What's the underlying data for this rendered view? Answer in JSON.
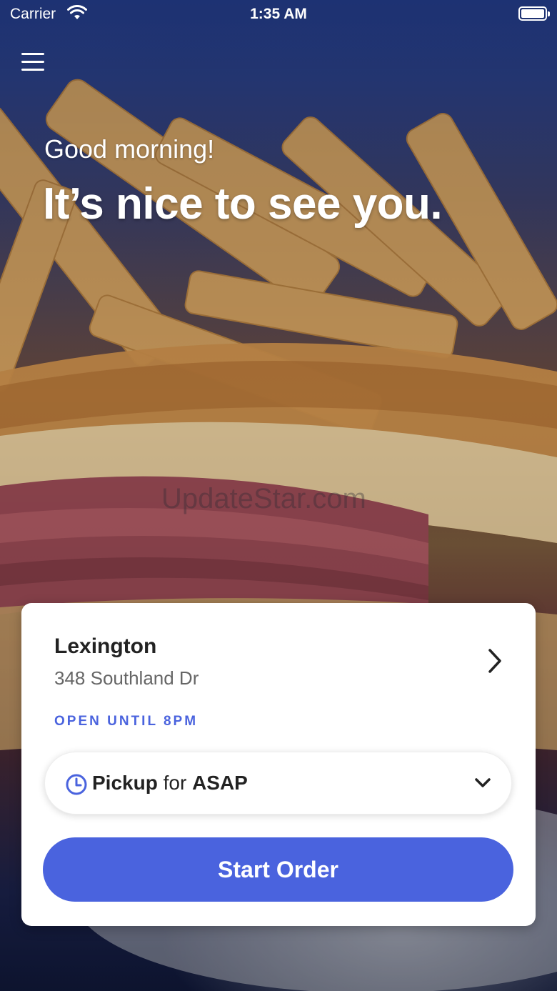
{
  "status_bar": {
    "carrier": "Carrier",
    "time": "1:35 AM"
  },
  "hero": {
    "greeting": "Good morning!",
    "headline": "It’s nice to see you.",
    "watermark": "UpdateStar.com"
  },
  "store": {
    "name": "Lexington",
    "address": "348 Southland Dr",
    "hours": "OPEN UNTIL 8PM"
  },
  "order_mode": {
    "mode": "Pickup",
    "connector": "for",
    "time": "ASAP"
  },
  "start_order_label": "Start Order",
  "colors": {
    "accent": "#4a63de",
    "card_bg": "#ffffff",
    "hero_top": "#233d8c"
  }
}
